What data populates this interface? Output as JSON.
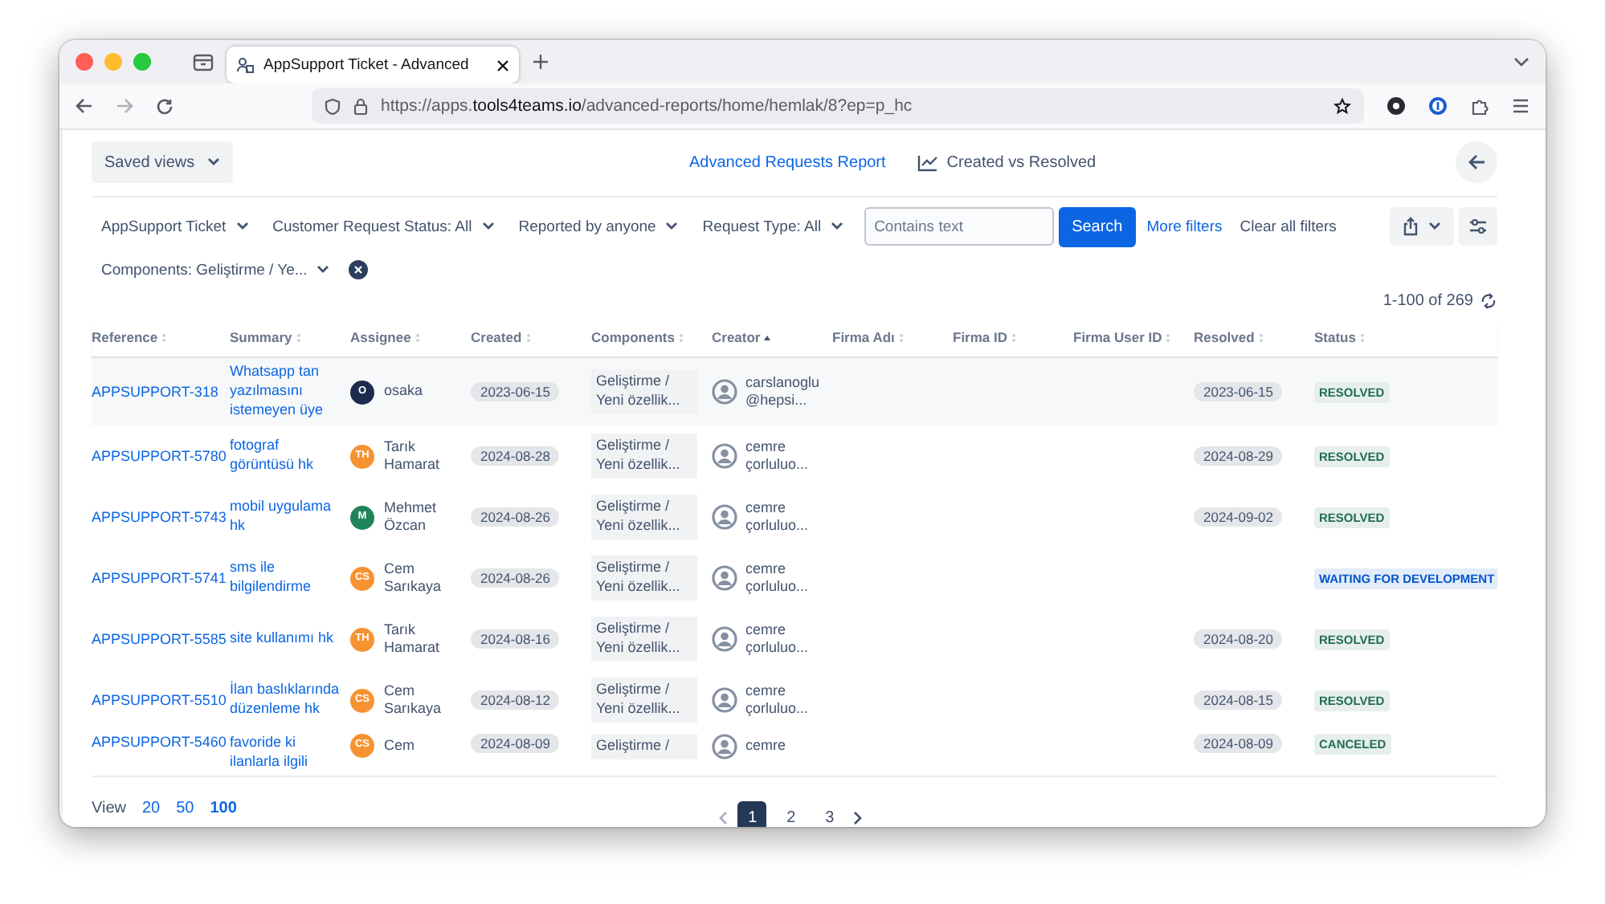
{
  "browser": {
    "tab": {
      "title": "AppSupport Ticket - Advanced"
    },
    "url": {
      "prefix": "https://apps.",
      "host": "tools4teams.io",
      "path": "/advanced-reports/home/hemlak/8?ep=p_hc"
    }
  },
  "toolbar": {
    "saved_views": "Saved views",
    "views": [
      {
        "label": "Advanced Requests Report",
        "selected": true,
        "kind": "text"
      },
      {
        "label": "Created vs Resolved",
        "selected": false,
        "kind": "chart"
      }
    ]
  },
  "filters": [
    "AppSupport Ticket",
    "Customer Request Status: All",
    "Reported by anyone",
    "Request Type: All"
  ],
  "search": {
    "placeholder": "Contains text",
    "button": "Search"
  },
  "more_filters": "More filters",
  "clear_filters": "Clear all filters",
  "component_filter": "Components: Geliştirme / Ye...",
  "count": "1-100 of 269",
  "table": {
    "columns": [
      {
        "label": "Reference",
        "sorted": false
      },
      {
        "label": "Summary",
        "sorted": false
      },
      {
        "label": "Assignee",
        "sorted": false
      },
      {
        "label": "Created",
        "sorted": false
      },
      {
        "label": "Components",
        "sorted": false
      },
      {
        "label": "Creator",
        "sorted": true
      },
      {
        "label": "Firma Adı",
        "sorted": false
      },
      {
        "label": "Firma ID",
        "sorted": false
      },
      {
        "label": "Firma User ID",
        "sorted": false
      },
      {
        "label": "Resolved",
        "sorted": false
      },
      {
        "label": "Status",
        "sorted": false
      }
    ],
    "rows": [
      {
        "highlighted": true,
        "reference": "APPSUPPORT-318",
        "summary": "Whatsapp tan yazılmasını istemeyen üye",
        "assignee": {
          "initials": "O",
          "name": "osaka",
          "color": "#1d2b4f"
        },
        "created": "2023-06-15",
        "components": "Geliştirme / Yeni özellik...",
        "creator": "carslanoglu@hepsi...",
        "resolved": "2023-06-15",
        "status": {
          "label": "RESOLVED",
          "color": "#216e4e"
        }
      },
      {
        "highlighted": false,
        "reference": "APPSUPPORT-5780",
        "summary": "fotograf görüntüsü hk",
        "assignee": {
          "initials": "TH",
          "name": "Tarık Hamarat",
          "color": "#f79232"
        },
        "created": "2024-08-28",
        "components": "Geliştirme / Yeni özellik...",
        "creator": "cemre çorluluo...",
        "resolved": "2024-08-29",
        "status": {
          "label": "RESOLVED",
          "color": "#216e4e"
        }
      },
      {
        "highlighted": false,
        "reference": "APPSUPPORT-5743",
        "summary": "mobil uygulama hk",
        "assignee": {
          "initials": "M",
          "name": "Mehmet Özcan",
          "color": "#1f845a"
        },
        "created": "2024-08-26",
        "components": "Geliştirme / Yeni özellik...",
        "creator": "cemre çorluluo...",
        "resolved": "2024-09-02",
        "status": {
          "label": "RESOLVED",
          "color": "#216e4e"
        }
      },
      {
        "highlighted": false,
        "reference": "APPSUPPORT-5741",
        "summary": "sms ile bilgilendirme",
        "assignee": {
          "initials": "CS",
          "name": "Cem Sarıkaya",
          "color": "#f79232"
        },
        "created": "2024-08-26",
        "components": "Geliştirme / Yeni özellik...",
        "creator": "cemre çorluluo...",
        "status": {
          "label": "WAITING FOR DEVELOPMENT",
          "color": "#0055cc"
        }
      },
      {
        "highlighted": false,
        "reference": "APPSUPPORT-5585",
        "summary": "site kullanımı hk",
        "assignee": {
          "initials": "TH",
          "name": "Tarık Hamarat",
          "color": "#f79232"
        },
        "created": "2024-08-16",
        "components": "Geliştirme / Yeni özellik...",
        "creator": "cemre çorluluo...",
        "resolved": "2024-08-20",
        "status": {
          "label": "RESOLVED",
          "color": "#216e4e"
        }
      },
      {
        "highlighted": false,
        "reference": "APPSUPPORT-5510",
        "summary": "İlan baslıklarında düzenleme hk",
        "assignee": {
          "initials": "CS",
          "name": "Cem Sarıkaya",
          "color": "#f79232"
        },
        "created": "2024-08-12",
        "components": "Geliştirme / Yeni özellik...",
        "creator": "cemre çorluluo...",
        "resolved": "2024-08-15",
        "status": {
          "label": "RESOLVED",
          "color": "#216e4e"
        }
      },
      {
        "highlighted": false,
        "reference": "APPSUPPORT-5460",
        "summary": "favoride ki ilanlarla ilgili",
        "assignee": {
          "initials": "CS",
          "name": "Cem",
          "color": "#f79232"
        },
        "created": "2024-08-09",
        "components": "Geliştirme /",
        "creator": "cemre",
        "resolved": "2024-08-09",
        "status": {
          "label": "CANCELED",
          "color": "#216e4e"
        }
      }
    ]
  },
  "footer": {
    "view_label": "View",
    "page_sizes": [
      {
        "label": "20",
        "selected": false
      },
      {
        "label": "50",
        "selected": false
      },
      {
        "label": "100",
        "selected": true
      }
    ],
    "pages": [
      {
        "label": "1",
        "selected": true
      },
      {
        "label": "2",
        "selected": false
      },
      {
        "label": "3",
        "selected": false
      }
    ]
  }
}
